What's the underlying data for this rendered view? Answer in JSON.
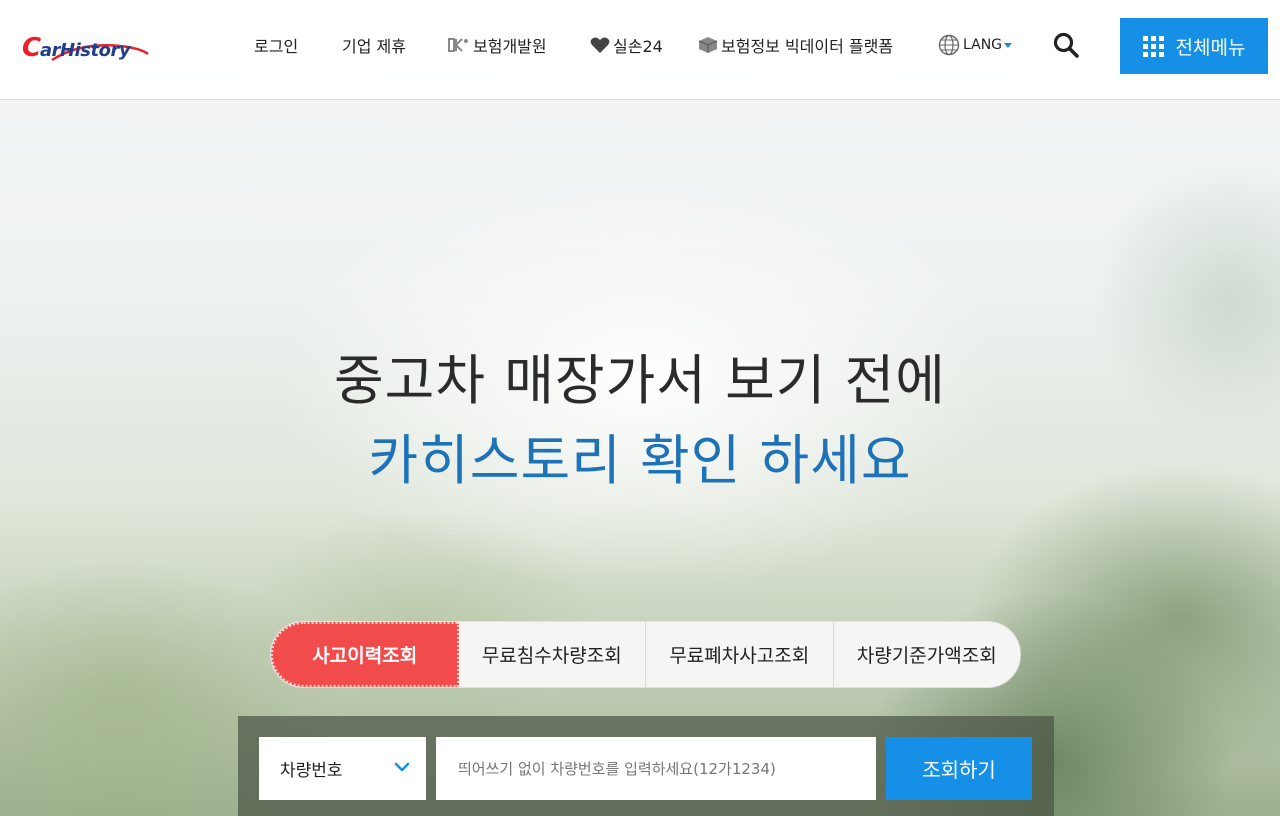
{
  "header": {
    "logo_text": "CarHistory",
    "nav": {
      "login": "로그인",
      "partnership": "기업 제휴",
      "kidi": "보험개발원",
      "silson24": "실손24",
      "bigdata": "보험정보 빅데이터 플랫폼",
      "lang": "LANG"
    },
    "menu_button": "전체메뉴"
  },
  "hero": {
    "line1": "중고차 매장가서 보기 전에",
    "line2": "카히스토리 확인 하세요"
  },
  "tabs": [
    {
      "label": "사고이력조회",
      "active": true
    },
    {
      "label": "무료침수차량조회",
      "active": false
    },
    {
      "label": "무료폐차사고조회",
      "active": false
    },
    {
      "label": "차량기준가액조회",
      "active": false
    }
  ],
  "search": {
    "select_value": "차량번호",
    "input_placeholder": "띄어쓰기 없이 차량번호를 입력하세요(12가1234)",
    "submit_label": "조회하기"
  },
  "colors": {
    "accent_blue": "#1590e6",
    "tab_active_red": "#f24b4b",
    "headline_blue": "#1e72b8",
    "logo_red": "#e8202a",
    "logo_navy": "#1f3d8a"
  },
  "icons": {
    "search": "search-icon",
    "menu": "grid-icon",
    "lang": "globe-icon",
    "select": "chevron-down-icon"
  }
}
